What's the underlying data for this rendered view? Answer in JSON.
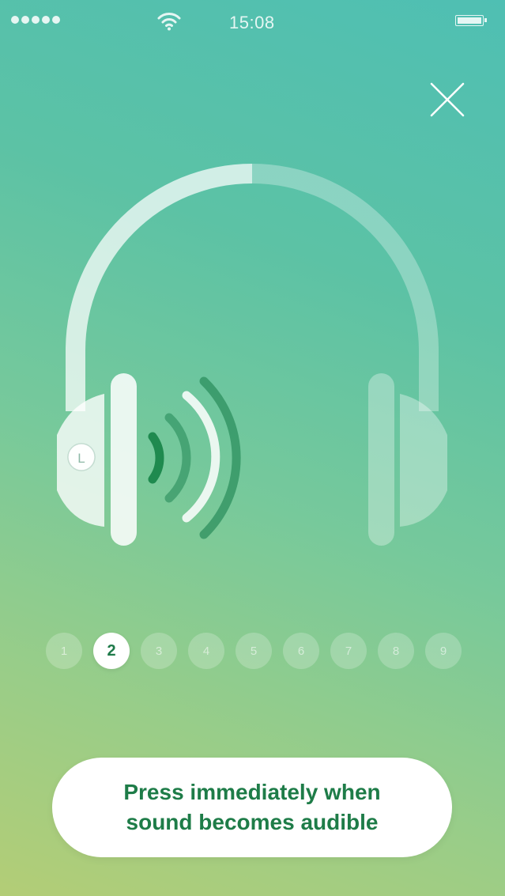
{
  "status_bar": {
    "signal_icon": "signal-dots-icon",
    "wifi_icon": "wifi-icon",
    "time": "15:08",
    "battery_icon": "battery-icon"
  },
  "close_icon": "close-icon",
  "headphones": {
    "left_label": "L",
    "sound_side": "left",
    "active_ear": "left"
  },
  "steps": {
    "items": [
      "1",
      "2",
      "3",
      "4",
      "5",
      "6",
      "7",
      "8",
      "9"
    ],
    "current": "2"
  },
  "action_button": {
    "line1": "Press immediately when",
    "line2": "sound becomes audible"
  },
  "colors": {
    "accent": "#1e7c48",
    "gradient_top": "#4fbfb3",
    "gradient_bottom": "#b3cd76"
  }
}
